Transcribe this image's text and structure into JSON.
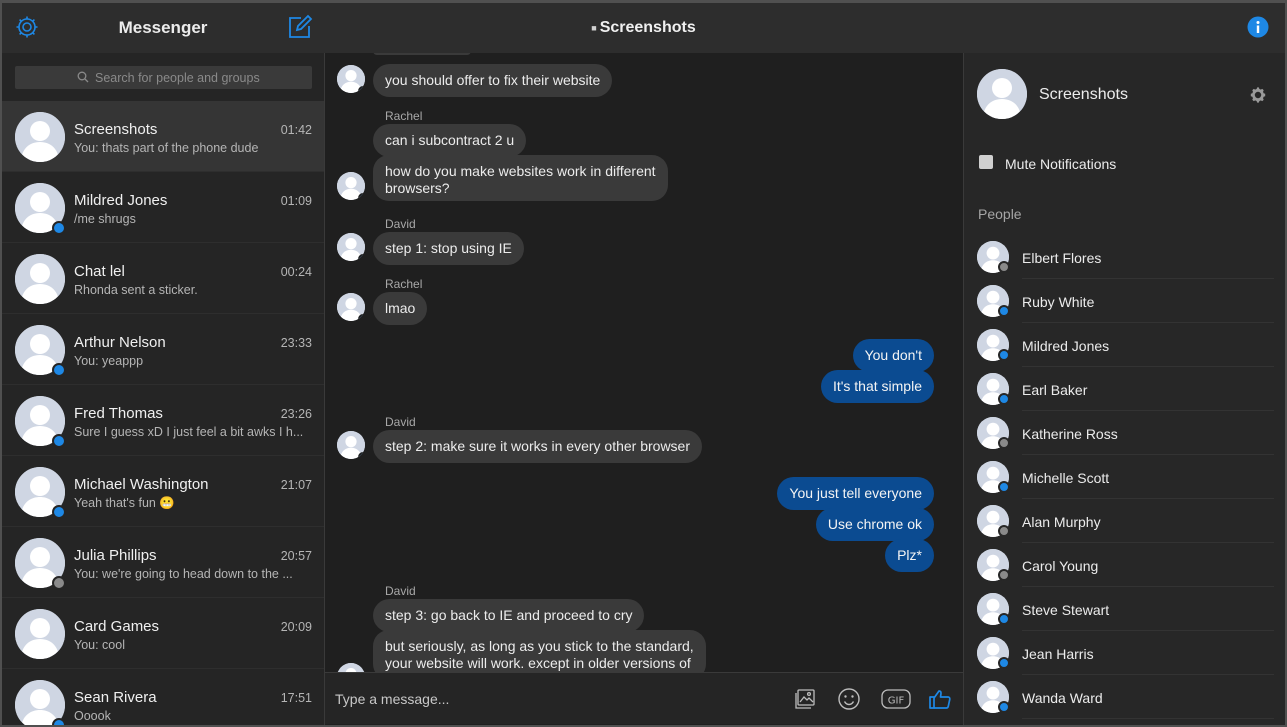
{
  "sidebar": {
    "title": "Messenger",
    "search_placeholder": "Search for people and groups",
    "conversations": [
      {
        "name": "Screenshots",
        "time": "01:42",
        "snippet": "You: thats part of the phone dude",
        "badge": "none",
        "active": true
      },
      {
        "name": "Mildred Jones",
        "time": "01:09",
        "snippet": "/me shrugs",
        "badge": "messenger"
      },
      {
        "name": "Chat lel",
        "time": "00:24",
        "snippet": "Rhonda sent a sticker.",
        "badge": "none"
      },
      {
        "name": "Arthur Nelson",
        "time": "23:33",
        "snippet": "You: yeappp",
        "badge": "messenger"
      },
      {
        "name": "Fred Thomas",
        "time": "23:26",
        "snippet": "Sure I guess xD I just feel a bit awks I h...",
        "badge": "messenger"
      },
      {
        "name": "Michael Washington",
        "time": "21:07",
        "snippet": "Yeah that's fun 😬",
        "badge": "messenger"
      },
      {
        "name": "Julia Phillips",
        "time": "20:57",
        "snippet": "You: we're going to head down to the ...",
        "badge": "facebook"
      },
      {
        "name": "Card Games",
        "time": "20:09",
        "snippet": "You: cool",
        "badge": "none"
      },
      {
        "name": "Sean Rivera",
        "time": "17:51",
        "snippet": "Ooook",
        "badge": "messenger"
      }
    ]
  },
  "chat": {
    "title": "Screenshots",
    "composer_placeholder": "Type a message...",
    "messages": [
      {
        "dir": "in",
        "text": "you should offer to fix their website"
      },
      {
        "sender": "Rachel"
      },
      {
        "dir": "in",
        "text": "can i subcontract 2 u"
      },
      {
        "dir": "in",
        "text": "how do you make websites work in different"
      },
      {
        "dir": "in",
        "text": "browsers?"
      },
      {
        "sender": "David"
      },
      {
        "dir": "in",
        "text": "step 1: stop using IE"
      },
      {
        "sender": "Rachel"
      },
      {
        "dir": "in",
        "text": "lmao"
      },
      {
        "dir": "out",
        "text": "You don't"
      },
      {
        "dir": "out",
        "text": "It's that simple"
      },
      {
        "sender": "David"
      },
      {
        "dir": "in",
        "text": "step 2: make sure it works in every other browser"
      },
      {
        "dir": "out",
        "text": "You just tell everyone"
      },
      {
        "dir": "out",
        "text": "Use chrome ok"
      },
      {
        "dir": "out",
        "text": "Plz*"
      },
      {
        "sender": "David"
      },
      {
        "dir": "in",
        "text": "step 3: go back to IE and proceed to cry"
      },
      {
        "dir": "in",
        "text": "but seriously, as long as you stick to the standard,"
      },
      {
        "dir": "in",
        "text": "your website will work. except in older versions of"
      }
    ]
  },
  "info_panel": {
    "name": "Screenshots",
    "mute_label": "Mute Notifications",
    "people_title": "People",
    "people": [
      {
        "name": "Elbert Flores",
        "badge": "facebook"
      },
      {
        "name": "Ruby White",
        "badge": "messenger"
      },
      {
        "name": "Mildred Jones",
        "badge": "messenger"
      },
      {
        "name": "Earl Baker",
        "badge": "messenger"
      },
      {
        "name": "Katherine Ross",
        "badge": "facebook"
      },
      {
        "name": "Michelle Scott",
        "badge": "messenger"
      },
      {
        "name": "Alan Murphy",
        "badge": "facebook"
      },
      {
        "name": "Carol Young",
        "badge": "facebook"
      },
      {
        "name": "Steve Stewart",
        "badge": "messenger"
      },
      {
        "name": "Jean Harris",
        "badge": "messenger"
      },
      {
        "name": "Wanda Ward",
        "badge": "messenger"
      }
    ]
  },
  "colors": {
    "accent": "#1e88e5",
    "outgoing_bubble": "#0b4b91",
    "incoming_bubble": "#3a3a3a",
    "background": "#1f1f1f"
  }
}
